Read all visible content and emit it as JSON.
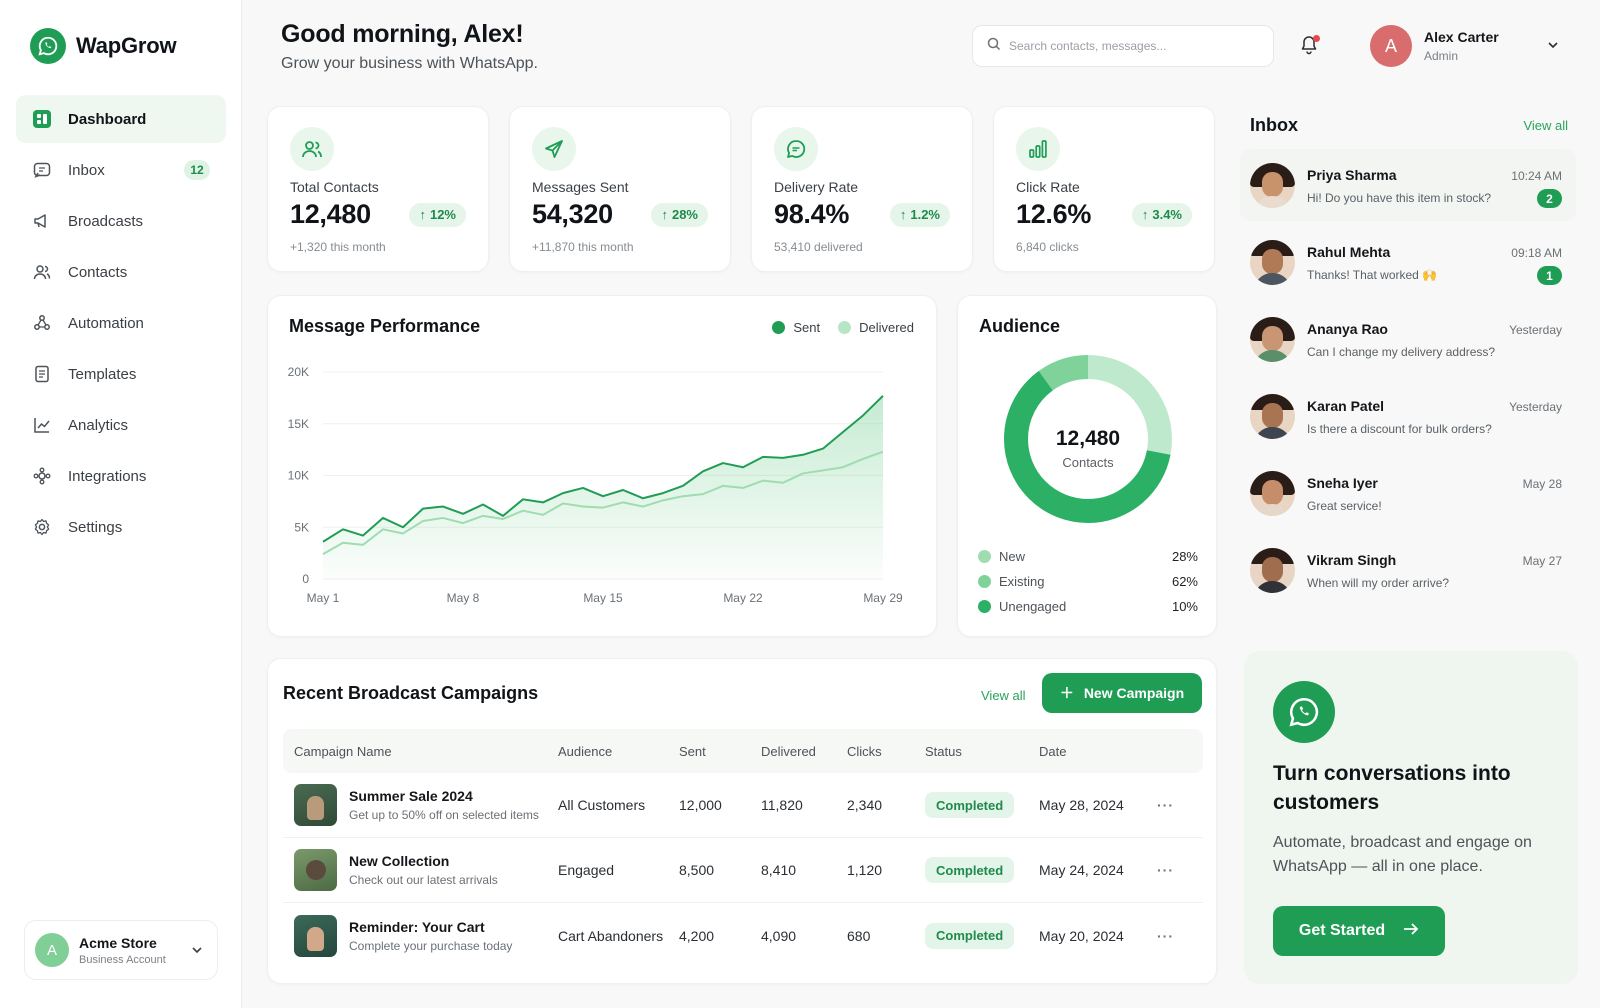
{
  "app": {
    "name": "WapGrow"
  },
  "sidebar": {
    "items": [
      {
        "label": "Dashboard",
        "icon": "dashboard-icon"
      },
      {
        "label": "Inbox",
        "icon": "inbox-icon",
        "badge": "12"
      },
      {
        "label": "Broadcasts",
        "icon": "broadcast-icon"
      },
      {
        "label": "Contacts",
        "icon": "contacts-icon"
      },
      {
        "label": "Automation",
        "icon": "automation-icon"
      },
      {
        "label": "Templates",
        "icon": "templates-icon"
      },
      {
        "label": "Analytics",
        "icon": "analytics-icon"
      },
      {
        "label": "Integrations",
        "icon": "integrations-icon"
      },
      {
        "label": "Settings",
        "icon": "settings-icon"
      }
    ],
    "account": {
      "initial": "A",
      "name": "Acme Store",
      "type": "Business Account"
    }
  },
  "header": {
    "greeting": "Good morning, Alex!",
    "subtitle": "Grow your business with WhatsApp.",
    "search_placeholder": "Search contacts, messages...",
    "user": {
      "initial": "A",
      "name": "Alex Carter",
      "role": "Admin"
    }
  },
  "stats": [
    {
      "label": "Total Contacts",
      "value": "12,480",
      "change": "12%",
      "sub": "+1,320 this month",
      "icon": "contacts-icon"
    },
    {
      "label": "Messages Sent",
      "value": "54,320",
      "change": "28%",
      "sub": "+11,870 this month",
      "icon": "send-icon"
    },
    {
      "label": "Delivery Rate",
      "value": "98.4%",
      "change": "1.2%",
      "sub": "53,410 delivered",
      "icon": "message-icon"
    },
    {
      "label": "Click Rate",
      "value": "12.6%",
      "change": "3.4%",
      "sub": "6,840 clicks",
      "icon": "bar-chart-icon"
    }
  ],
  "performance": {
    "title": "Message Performance",
    "legend": [
      "Sent",
      "Delivered"
    ]
  },
  "chart_data": [
    {
      "type": "line",
      "title": "Message Performance",
      "x_ticks": [
        "May 1",
        "May 8",
        "May 15",
        "May 22",
        "May 29"
      ],
      "y_ticks": [
        "0",
        "5K",
        "10K",
        "15K",
        "20K"
      ],
      "ylim": [
        0,
        20000
      ],
      "grid": true,
      "legend_position": "top-right",
      "x": [
        "May 1",
        "May 2",
        "May 3",
        "May 4",
        "May 5",
        "May 6",
        "May 7",
        "May 8",
        "May 9",
        "May 10",
        "May 11",
        "May 12",
        "May 13",
        "May 14",
        "May 15",
        "May 16",
        "May 17",
        "May 18",
        "May 19",
        "May 20",
        "May 21",
        "May 22",
        "May 23",
        "May 24",
        "May 25",
        "May 26",
        "May 27",
        "May 28",
        "May 29"
      ],
      "series": [
        {
          "name": "Sent",
          "color": "#1f9d55",
          "values": [
            3600,
            4800,
            4200,
            5900,
            5000,
            6800,
            7000,
            6300,
            7200,
            6100,
            7700,
            7400,
            8300,
            8800,
            8000,
            8600,
            7800,
            8300,
            9000,
            10400,
            11200,
            10800,
            11800,
            11700,
            12000,
            12600,
            14200,
            15800,
            17700
          ]
        },
        {
          "name": "Delivered",
          "color": "#9fdcb0",
          "values": [
            2400,
            3500,
            3300,
            4800,
            4400,
            5600,
            5900,
            5400,
            6100,
            5800,
            6600,
            6200,
            7300,
            7000,
            6900,
            7400,
            7000,
            7600,
            8000,
            8200,
            9000,
            8800,
            9500,
            9300,
            10200,
            10500,
            10800,
            11600,
            12300
          ]
        }
      ]
    },
    {
      "type": "pie",
      "title": "Audience",
      "center_value": "12,480",
      "center_label": "Contacts",
      "categories": [
        "New",
        "Existing",
        "Unengaged"
      ],
      "values": [
        28,
        62,
        10
      ],
      "colors": [
        "#bfe9cc",
        "#2bb065",
        "#7fd39a"
      ]
    }
  ],
  "audience": {
    "title": "Audience",
    "total": "12,480",
    "total_label": "Contacts",
    "rows": [
      {
        "label": "New",
        "pct": "28%"
      },
      {
        "label": "Existing",
        "pct": "62%"
      },
      {
        "label": "Unengaged",
        "pct": "10%"
      }
    ]
  },
  "campaigns": {
    "title": "Recent Broadcast Campaigns",
    "view_all": "View all",
    "new_button": "New Campaign",
    "columns": [
      "Campaign Name",
      "Audience",
      "Sent",
      "Delivered",
      "Clicks",
      "Status",
      "Date"
    ],
    "rows": [
      {
        "name": "Summer Sale 2024",
        "desc": "Get up to 50% off on selected items",
        "audience": "All Customers",
        "sent": "12,000",
        "delivered": "11,820",
        "clicks": "2,340",
        "status": "Completed",
        "date": "May 28, 2024"
      },
      {
        "name": "New Collection",
        "desc": "Check out our latest arrivals",
        "audience": "Engaged",
        "sent": "8,500",
        "delivered": "8,410",
        "clicks": "1,120",
        "status": "Completed",
        "date": "May 24, 2024"
      },
      {
        "name": "Reminder: Your Cart",
        "desc": "Complete your purchase today",
        "audience": "Cart Abandoners",
        "sent": "4,200",
        "delivered": "4,090",
        "clicks": "680",
        "status": "Completed",
        "date": "May 20, 2024"
      }
    ]
  },
  "inbox": {
    "title": "Inbox",
    "view_all": "View all",
    "messages": [
      {
        "name": "Priya Sharma",
        "text": "Hi! Do you have this item in stock?",
        "time": "10:24 AM",
        "unread": "2"
      },
      {
        "name": "Rahul Mehta",
        "text": "Thanks! That worked 🙌",
        "time": "09:18 AM",
        "unread": "1"
      },
      {
        "name": "Ananya Rao",
        "text": "Can I change my delivery address?",
        "time": "Yesterday"
      },
      {
        "name": "Karan Patel",
        "text": "Is there a discount for bulk orders?",
        "time": "Yesterday"
      },
      {
        "name": "Sneha Iyer",
        "text": "Great service!",
        "time": "May 28"
      },
      {
        "name": "Vikram Singh",
        "text": "When will my order arrive?",
        "time": "May 27"
      }
    ]
  },
  "promo": {
    "title": "Turn conversations into customers",
    "text": "Automate, broadcast and engage on WhatsApp — all in one place.",
    "button": "Get Started"
  },
  "colors": {
    "accent": "#1f9d55",
    "accent_light": "#e5f5e9",
    "delivered": "#9fdcb0"
  }
}
